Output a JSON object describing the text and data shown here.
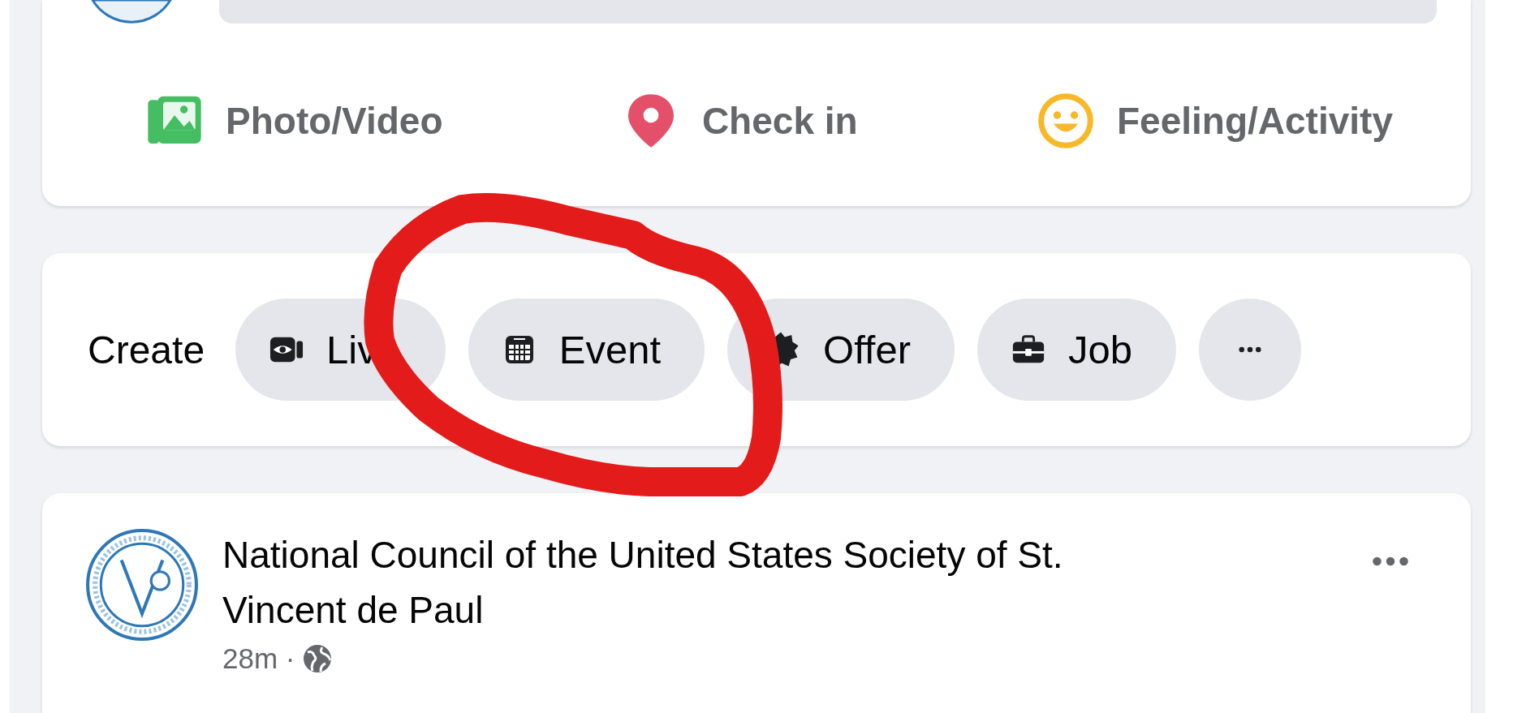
{
  "composer": {
    "actions": [
      {
        "label": "Photo/Video",
        "kind": "photo"
      },
      {
        "label": "Check in",
        "kind": "checkin"
      },
      {
        "label": "Feeling/Activity",
        "kind": "feeling"
      }
    ]
  },
  "create_bar": {
    "label": "Create",
    "buttons": [
      {
        "label": "Liv",
        "kind": "live"
      },
      {
        "label": "Event",
        "kind": "event"
      },
      {
        "label": "Offer",
        "kind": "offer"
      },
      {
        "label": "Job",
        "kind": "job"
      },
      {
        "kind": "more"
      }
    ]
  },
  "post": {
    "author": "National Council of the United States Society of St. Vincent de Paul",
    "time": "28m ·"
  },
  "annotation": {
    "kind": "circle"
  }
}
